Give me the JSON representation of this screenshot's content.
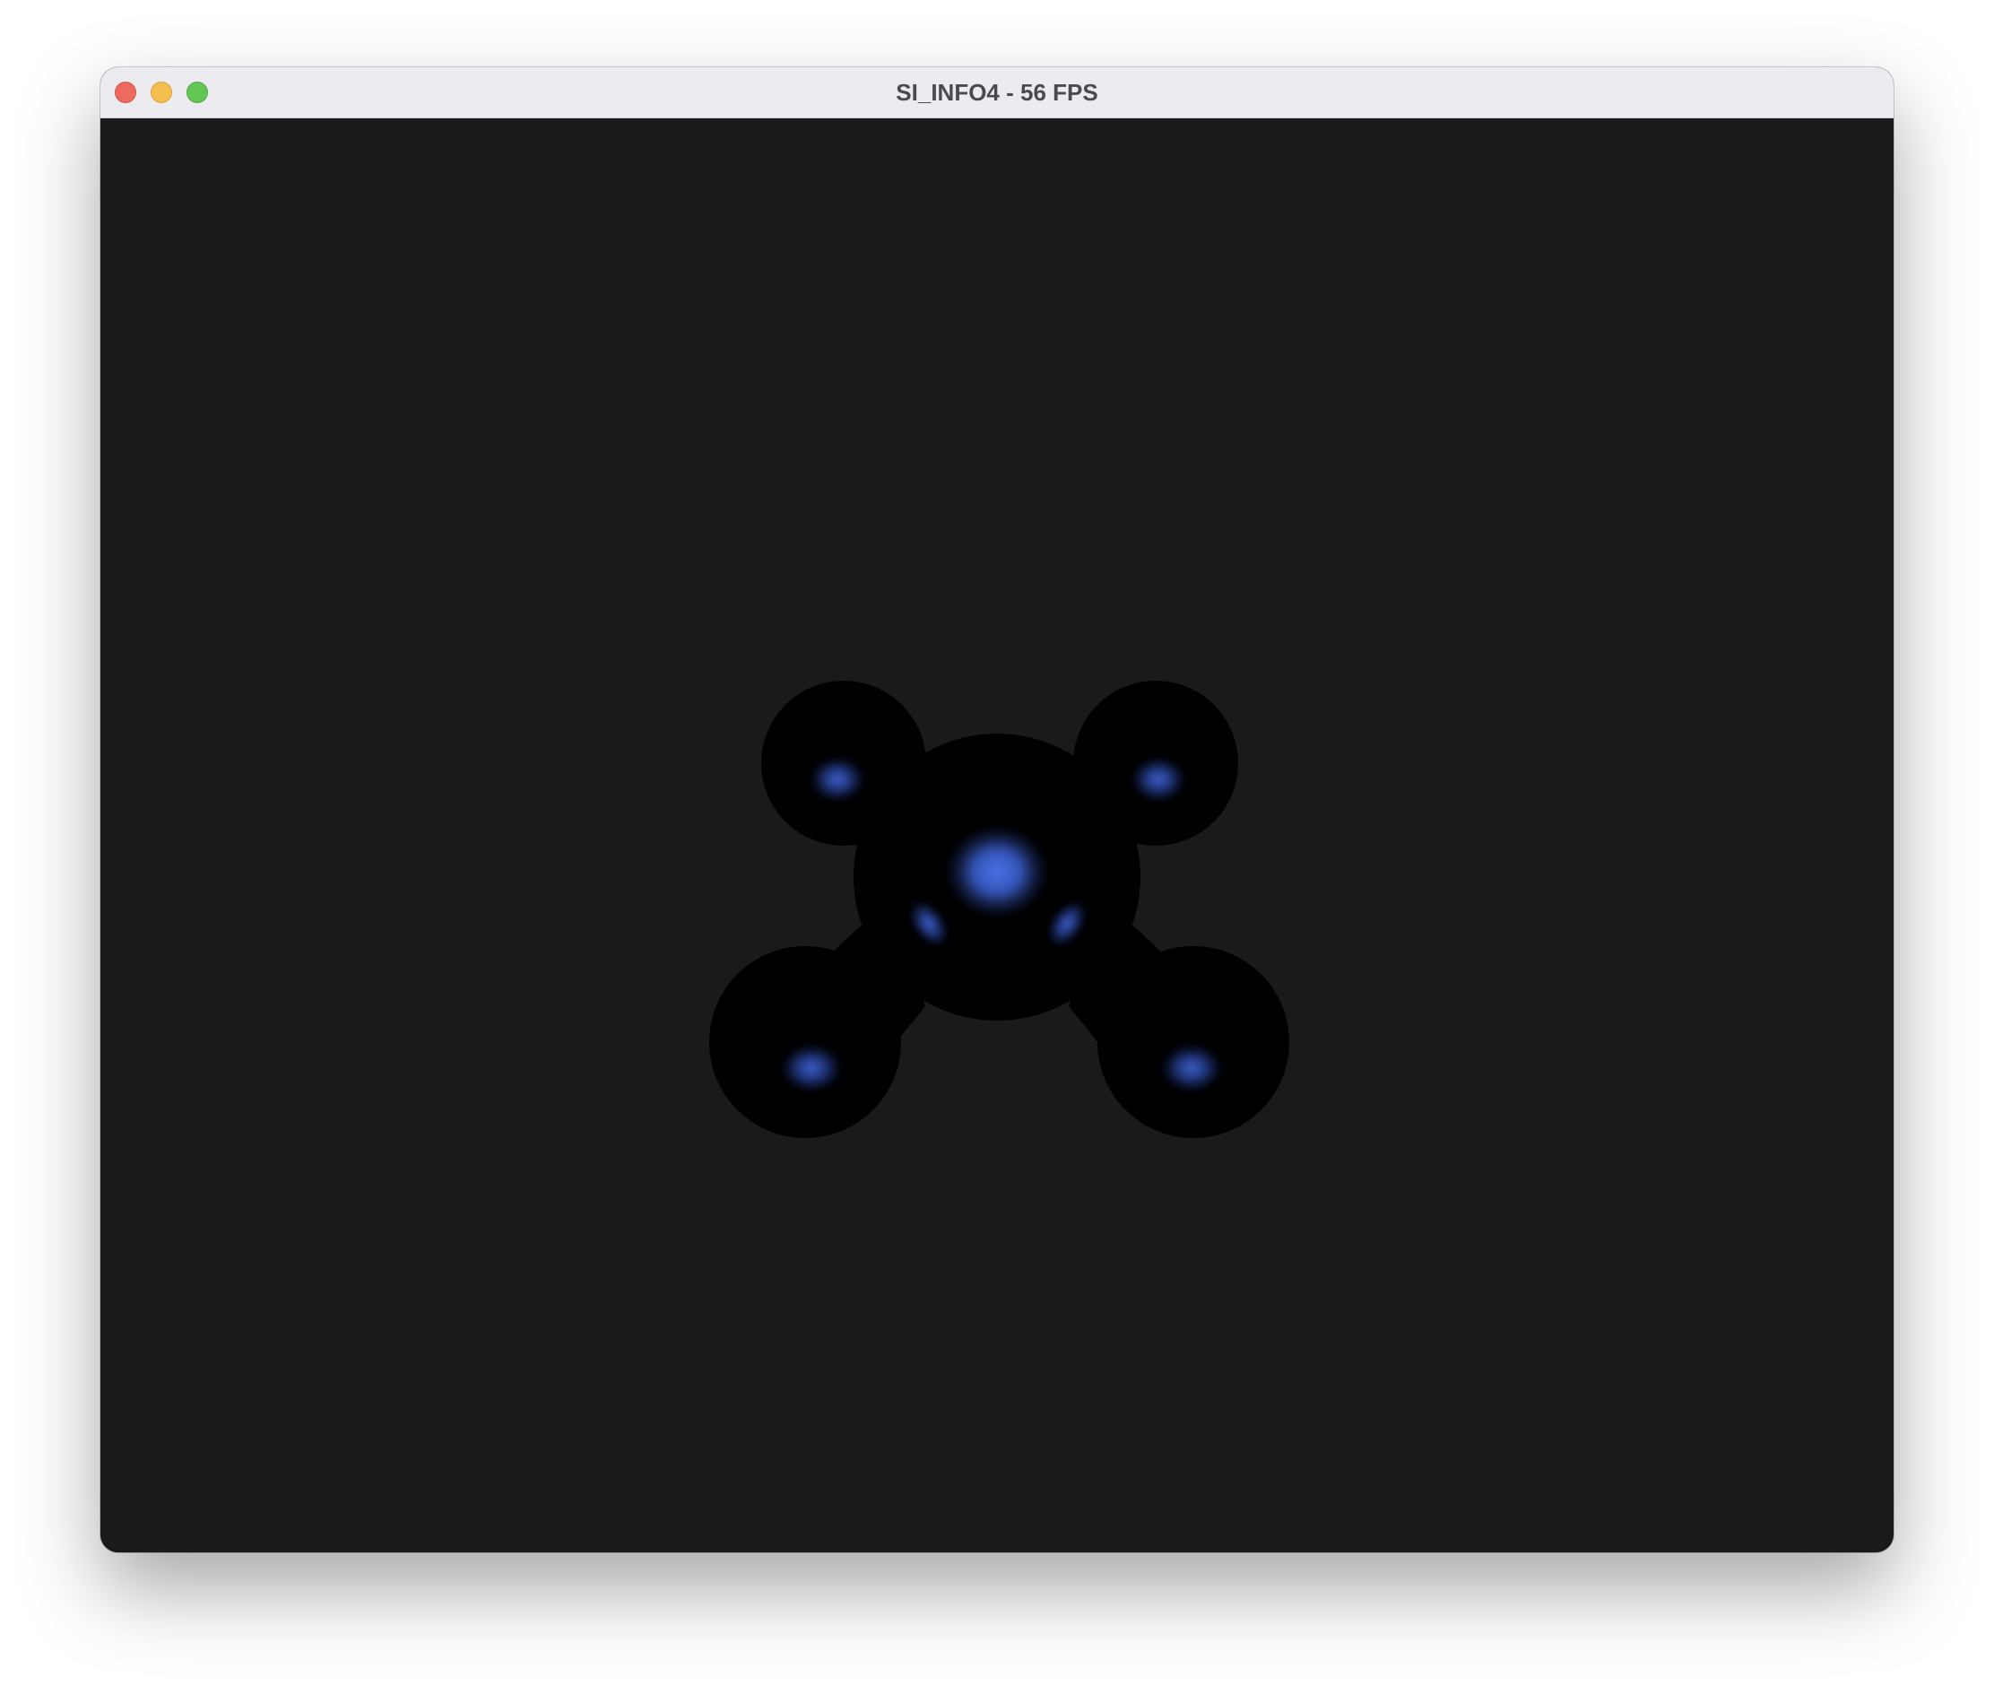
{
  "window": {
    "title": "SI_INFO4 - 56 FPS",
    "controls": [
      "close",
      "minimize",
      "zoom"
    ]
  },
  "viewport": {
    "background_color": "#1a1a1a",
    "object": {
      "body_color": "#000000",
      "glow_color": "#3d63d6"
    }
  }
}
